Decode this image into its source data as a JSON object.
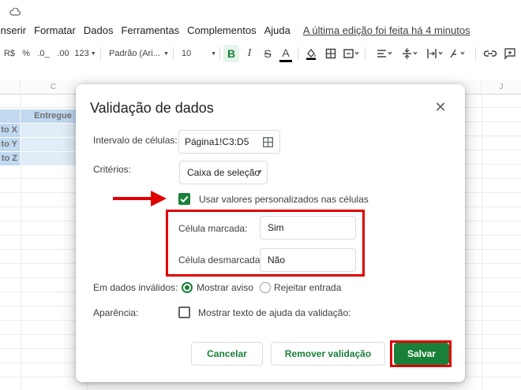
{
  "menu": {
    "items": [
      "Inserir",
      "Formatar",
      "Dados",
      "Ferramentas",
      "Complementos",
      "Ajuda"
    ],
    "last_edit": "A última edição foi feita há 4 minutos"
  },
  "toolbar": {
    "currency": "R$",
    "percent": "%",
    "dec_less": ".0_",
    "dec_more": ".00",
    "number_format": "123",
    "font": "Padrão (Ari...",
    "font_size": "10",
    "bold": "B",
    "italic": "I",
    "strike": "S",
    "text_color": "A"
  },
  "sheet": {
    "columns": [
      "C",
      "J"
    ],
    "header_cell": "Entregue",
    "row_labels": [
      "to X",
      "to Y",
      "to Z"
    ]
  },
  "dialog": {
    "title": "Validação de dados",
    "range_label": "Intervalo de células:",
    "range_value": "Página1!C3:D5",
    "criteria_label": "Critérios:",
    "criteria_value": "Caixa de seleção",
    "custom_values_label": "Usar valores personalizados nas células",
    "checked_label": "Célula marcada:",
    "checked_value": "Sim",
    "unchecked_label": "Célula desmarcada:",
    "unchecked_value": "Não",
    "invalid_label": "Em dados inválidos:",
    "show_warning": "Mostrar aviso",
    "reject_input": "Rejeitar entrada",
    "appearance_label": "Aparência:",
    "help_text_label": "Mostrar texto de ajuda da validação:",
    "cancel": "Cancelar",
    "remove": "Remover validação",
    "save": "Salvar"
  },
  "colors": {
    "accent_green": "#188038",
    "highlight_red": "#e00000",
    "header_blue": "#9fc5e8",
    "cell_blue": "#cfe2f3"
  }
}
